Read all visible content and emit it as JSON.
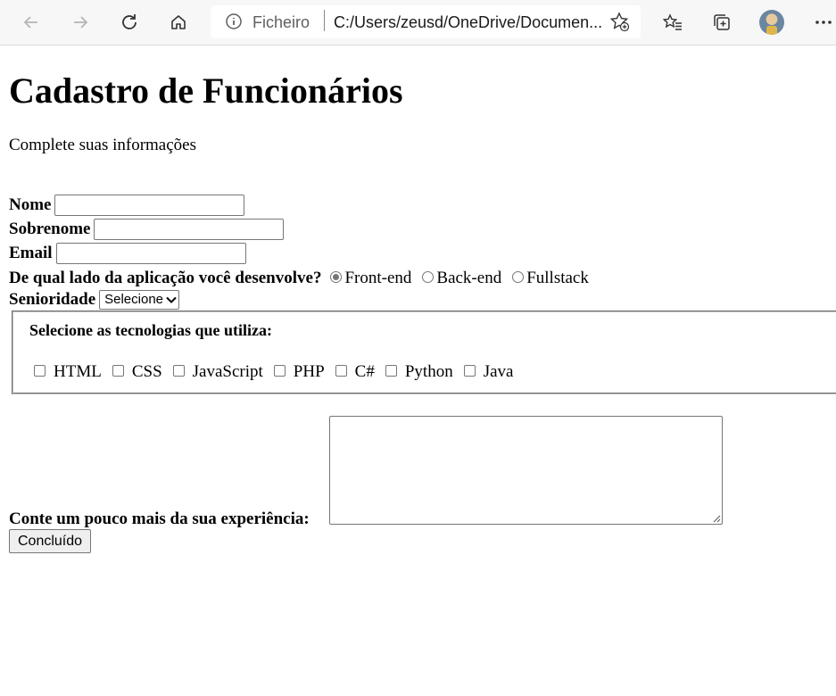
{
  "browser": {
    "site_info_label": "Ficheiro",
    "url": "C:/Users/zeusd/OneDrive/Documen...",
    "icons": [
      "back-icon",
      "forward-icon",
      "refresh-icon",
      "home-icon",
      "info-icon",
      "add-favorite-icon",
      "favorites-icon",
      "collections-icon",
      "profile-avatar",
      "more-icon"
    ]
  },
  "page": {
    "title": "Cadastro de Funcionários",
    "subtitle": "Complete suas informações"
  },
  "form": {
    "nome_label": "Nome",
    "nome_value": "",
    "sobrenome_label": "Sobrenome",
    "sobrenome_value": "",
    "email_label": "Email",
    "email_value": "",
    "side_question": "De qual lado da aplicação você desenvolve?",
    "side_options": [
      "Front-end",
      "Back-end",
      "Fullstack"
    ],
    "side_selected": "Front-end",
    "senioridade_label": "Senioridade",
    "senioridade_selected": "Selecione",
    "tech_legend": "Selecione as tecnologias que utiliza:",
    "tech_options": [
      "HTML",
      "CSS",
      "JavaScript",
      "PHP",
      "C#",
      "Python",
      "Java"
    ],
    "experience_label": "Conte um pouco mais da sua experiência:",
    "experience_value": "",
    "submit_label": "Concluído"
  }
}
